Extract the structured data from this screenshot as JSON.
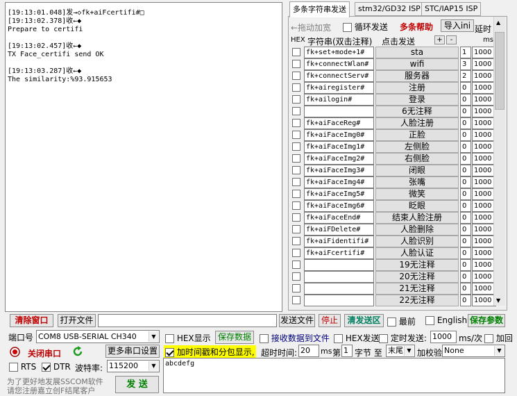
{
  "log": {
    "lines": [
      "[19:13:01.048]发→◇fk+aiFcertifi#□",
      "[19:13:02.378]收←◆",
      "Prepare to certifi",
      "",
      "[19:13:02.457]收←◆",
      "TX Face_certifi send OK",
      "",
      "[19:13:03.287]收←◆",
      "The similarity:%93.915653"
    ]
  },
  "tabs": [
    "多条字符串发送",
    "stm32/GD32 ISP",
    "STC/IAP15 ISP"
  ],
  "multi": {
    "collapse_label": "←拖动加宽",
    "loop_label": "循环发送",
    "help_label": "多条帮助",
    "import_label": "导入ini",
    "delay_label": "延时",
    "hex_header": "HEX",
    "str_header": "字符串(双击注释)",
    "send_header": "点击发送",
    "plus": "+",
    "minus": "-",
    "ms": "ms",
    "rows": [
      {
        "text": "fk+set+mode+1#",
        "label": "sta",
        "order": "1",
        "delay": "1000"
      },
      {
        "text": "fk+connectWlan#",
        "label": "wifi",
        "order": "3",
        "delay": "1000"
      },
      {
        "text": "fk+connectServ#",
        "label": "服务器",
        "order": "2",
        "delay": "1000"
      },
      {
        "text": "fk+airegister#",
        "label": "注册",
        "order": "0",
        "delay": "1000"
      },
      {
        "text": "fk+ailogin#",
        "label": "登录",
        "order": "0",
        "delay": "1000"
      },
      {
        "text": "",
        "label": "6无注释",
        "order": "0",
        "delay": "1000"
      },
      {
        "text": "fk+aiFaceReg#",
        "label": "人脸注册",
        "order": "0",
        "delay": "1000"
      },
      {
        "text": "fk+aiFaceImg0#",
        "label": "正脸",
        "order": "0",
        "delay": "1000"
      },
      {
        "text": "fk+aiFaceImg1#",
        "label": "左侧脸",
        "order": "0",
        "delay": "1000"
      },
      {
        "text": "fk+aiFaceImg2#",
        "label": "右侧脸",
        "order": "0",
        "delay": "1000"
      },
      {
        "text": "fk+aiFaceImg3#",
        "label": "闭眼",
        "order": "0",
        "delay": "1000"
      },
      {
        "text": "fk+aiFaceImg4#",
        "label": "张嘴",
        "order": "0",
        "delay": "1000"
      },
      {
        "text": "fk+aiFaceImg5#",
        "label": "微笑",
        "order": "0",
        "delay": "1000"
      },
      {
        "text": "fk+aiFaceImg6#",
        "label": "眨眼",
        "order": "0",
        "delay": "1000"
      },
      {
        "text": "fk+aiFaceEnd#",
        "label": "结束人脸注册",
        "order": "0",
        "delay": "1000"
      },
      {
        "text": "fk+aiFDelete#",
        "label": "人脸删除",
        "order": "0",
        "delay": "1000"
      },
      {
        "text": "fk+aiFidentifi#",
        "label": "人脸识别",
        "order": "0",
        "delay": "1000"
      },
      {
        "text": "fk+aiFcertifi#",
        "label": "人脸认证",
        "order": "0",
        "delay": "1000"
      },
      {
        "text": "",
        "label": "19无注释",
        "order": "0",
        "delay": "1000"
      },
      {
        "text": "",
        "label": "20无注释",
        "order": "0",
        "delay": "1000"
      },
      {
        "text": "",
        "label": "21无注释",
        "order": "0",
        "delay": "1000"
      },
      {
        "text": "",
        "label": "22无注释",
        "order": "0",
        "delay": "1000"
      }
    ]
  },
  "toolbar": {
    "clear": "清除窗口",
    "open_file": "打开文件",
    "send_file": "发送文件",
    "stop": "停止",
    "clear_send": "清发送区",
    "topmost": "最前",
    "english": "English",
    "save_params": "保存参数"
  },
  "port": {
    "port_label": "端口号",
    "port_value": "COM8 USB-SERIAL CH340",
    "close_port": "关闭串口",
    "more_settings": "更多串口设置",
    "rts": "RTS",
    "dtr": "DTR",
    "baud_label": "波特率:",
    "baud_value": "115200",
    "promo1": "为了更好地发展SSCOM软件",
    "promo2": "请您注册嘉立创F结尾客户",
    "send_button": "发 送"
  },
  "options": {
    "hex_display": "HEX显示",
    "save_data": "保存数据",
    "recv_to_file": "接收数据到文件",
    "hex_send": "HEX发送",
    "timed_send": "定时发送:",
    "interval": "1000",
    "interval_unit": "ms/次",
    "add_return": "加回",
    "timestamp": "加时间戳和分包显示,",
    "timeout_label": "超时时间:",
    "timeout_value": "20",
    "ms": "ms",
    "nth": "第",
    "nth_value": "1",
    "byte_to": "字节 至",
    "end_value": "末尾",
    "checksum": "加校验",
    "checksum_value": "None"
  },
  "send_area": {
    "text": "abcdefg"
  }
}
